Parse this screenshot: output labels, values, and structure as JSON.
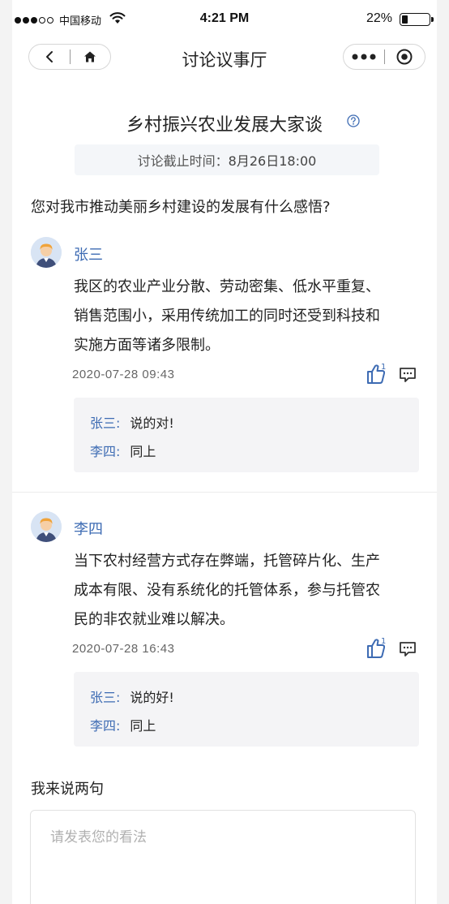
{
  "status_bar": {
    "carrier": "中国移动",
    "time": "4:21 PM",
    "battery": "22%",
    "battery_level": 0.22
  },
  "nav": {
    "title": "讨论议事厅"
  },
  "topic": {
    "title": "乡村振兴农业发展大家谈",
    "deadline_label": "讨论截止时间：",
    "deadline_value": "8月26日18:00",
    "question": "您对我市推动美丽乡村建设的发展有什么感悟?"
  },
  "comments": [
    {
      "author": "张三",
      "lines": [
        "我区的农业产业分散、劳动密集、低水平重复、",
        "销售范围小，采用传统加工的同时还受到科技和",
        "实施方面等诸多限制。"
      ],
      "time": "2020-07-28   09:43",
      "likes": "1",
      "replies": [
        {
          "name": "张三:",
          "text": "说的对!"
        },
        {
          "name": "李四:",
          "text": "同上"
        }
      ]
    },
    {
      "author": "李四",
      "lines": [
        "当下农村经营方式存在弊端，托管碎片化、生产",
        "成本有限、没有系统化的托管体系，参与托管农",
        "民的非农就业难以解决。"
      ],
      "time": "2020-07-28   16:43",
      "likes": "1",
      "replies": [
        {
          "name": "张三:",
          "text": "说的好!"
        },
        {
          "name": "李四:",
          "text": "同上"
        }
      ]
    }
  ],
  "compose": {
    "title": "我来说两句",
    "placeholder": "请发表您的看法"
  },
  "colors": {
    "accent": "#3d6bb3",
    "reply_bg": "#f4f4f6"
  }
}
